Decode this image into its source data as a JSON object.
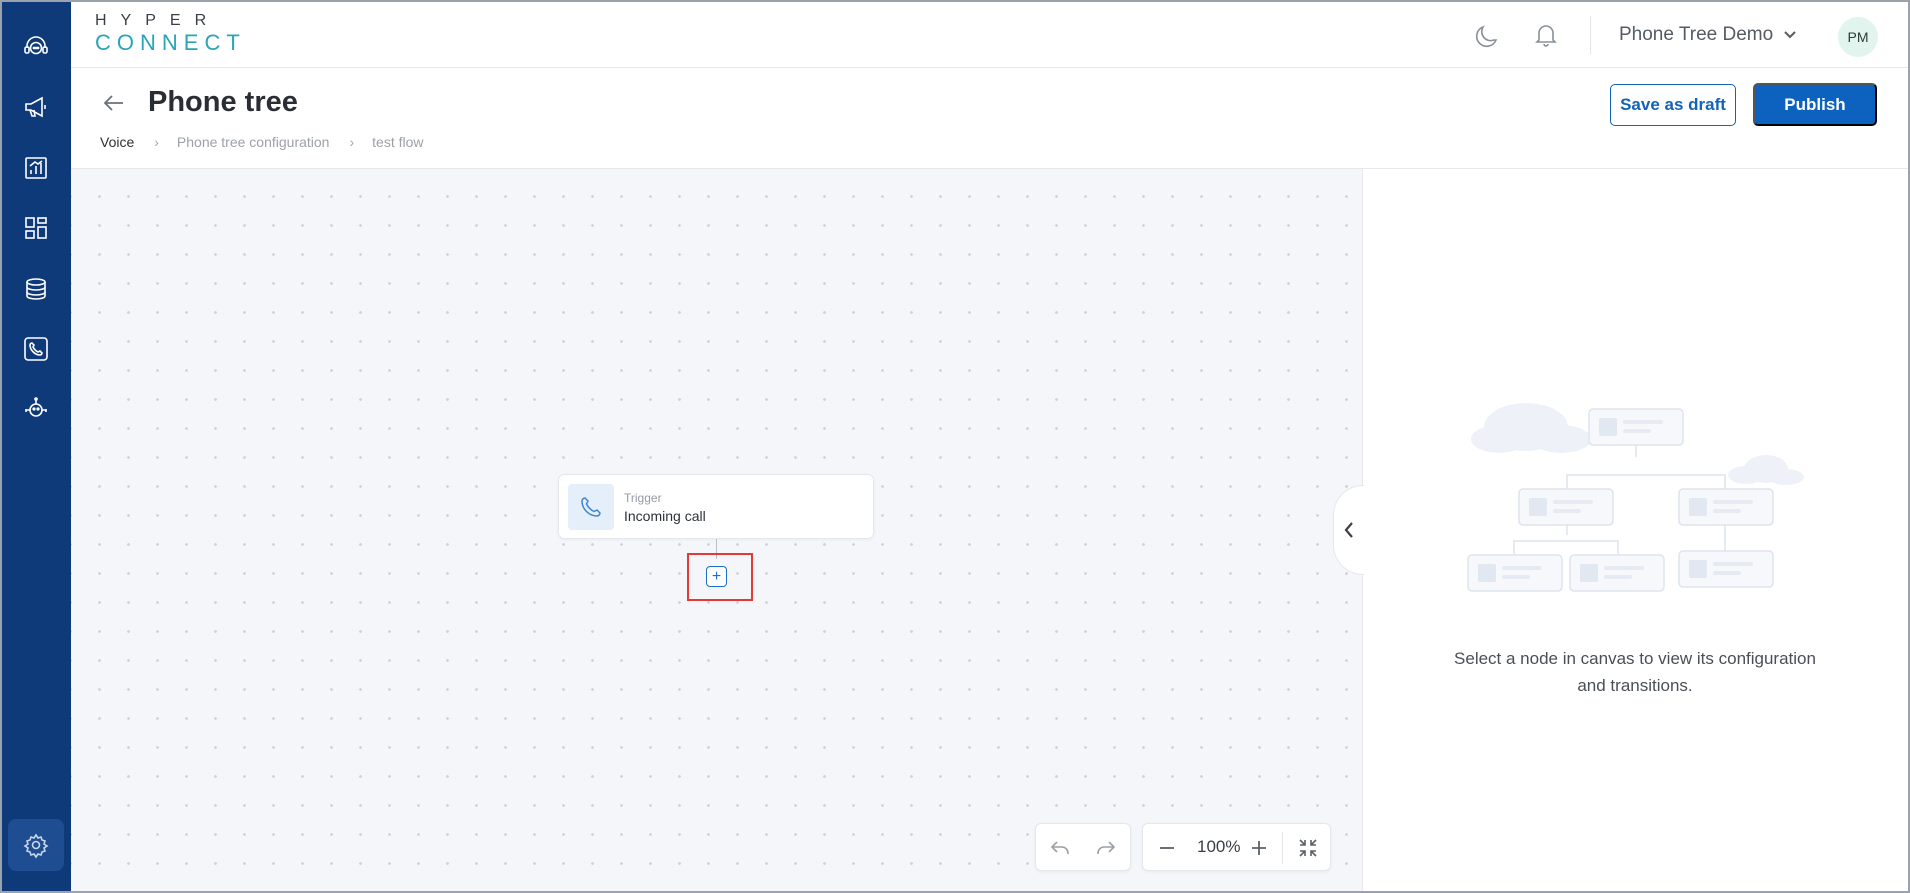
{
  "sidebar": {
    "items": [
      {
        "icon": "headset-icon"
      },
      {
        "icon": "megaphone-icon"
      },
      {
        "icon": "report-icon"
      },
      {
        "icon": "dashboard-icon"
      },
      {
        "icon": "database-icon"
      },
      {
        "icon": "phone-icon"
      },
      {
        "icon": "bot-icon"
      }
    ],
    "settings_icon": "gear-icon"
  },
  "header": {
    "logo_top": "HYPER",
    "logo_bottom": "CONNECT",
    "account_name": "Phone Tree Demo",
    "avatar_initials": "PM"
  },
  "page": {
    "title": "Phone tree",
    "breadcrumb": [
      "Voice",
      "Phone tree configuration",
      "test flow"
    ],
    "save_draft_label": "Save as draft",
    "publish_label": "Publish"
  },
  "canvas": {
    "trigger_node": {
      "kind": "Trigger",
      "label": "Incoming call"
    },
    "add_button_label": "+",
    "zoom": "100%"
  },
  "panel": {
    "empty_message": "Select a node in canvas to view its configuration and transitions."
  },
  "colors": {
    "sidebar": "#0e3a7a",
    "accent": "#0d62bf",
    "highlight": "#e53935",
    "logo_teal": "#2aa5b8"
  }
}
